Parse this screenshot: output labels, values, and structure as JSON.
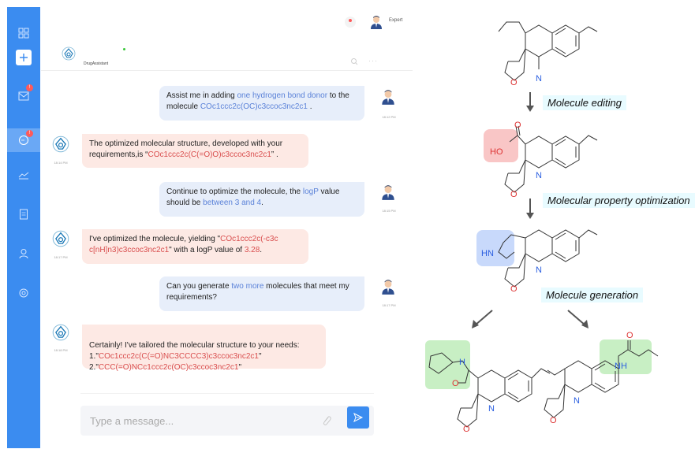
{
  "app": {
    "assistant_name": "DrugAssistant",
    "user_role": "Expert"
  },
  "sidebar": {
    "items": [
      {
        "icon": "grid-icon"
      },
      {
        "icon": "plus-icon"
      },
      {
        "icon": "mail-icon",
        "badge": "!"
      },
      {
        "icon": "chat-icon",
        "badge": "!"
      },
      {
        "icon": "chart-icon"
      },
      {
        "icon": "document-icon"
      },
      {
        "icon": "user-icon"
      },
      {
        "icon": "settings-icon"
      }
    ]
  },
  "messages": [
    {
      "role": "user",
      "time": "18:12 PM",
      "parts": [
        {
          "t": "Assist me in adding "
        },
        {
          "t": "one hydrogen bond donor",
          "c": "blue"
        },
        {
          "t": " to the molecule "
        },
        {
          "t": "COc1ccc2c(OC)c3ccoc3nc2c1",
          "c": "blue"
        },
        {
          "t": " ."
        }
      ]
    },
    {
      "role": "bot",
      "time": "18:14 PM",
      "parts": [
        {
          "t": "The optimized molecular structure, developed with your requirements,is “"
        },
        {
          "t": "COc1ccc2c(C(=O)O)c3ccoc3nc2c1",
          "c": "red"
        },
        {
          "t": "” ."
        }
      ]
    },
    {
      "role": "user",
      "time": "18:15 PM",
      "parts": [
        {
          "t": "Continue to optimize the molecule, the "
        },
        {
          "t": "logP",
          "c": "blue"
        },
        {
          "t": " value should be "
        },
        {
          "t": "between 3 and 4",
          "c": "blue"
        },
        {
          "t": "."
        }
      ]
    },
    {
      "role": "bot",
      "time": "18:17 PM",
      "parts": [
        {
          "t": "I've optimized the molecule, yielding \""
        },
        {
          "t": "COc1ccc2c(-c3c c[nH]n3)c3ccoc3nc2c1",
          "c": "red"
        },
        {
          "t": "\" with a logP value of "
        },
        {
          "t": "3.28",
          "c": "red"
        },
        {
          "t": "."
        }
      ]
    },
    {
      "role": "user",
      "time": "18:17 PM",
      "parts": [
        {
          "t": "Can you generate "
        },
        {
          "t": "two more",
          "c": "blue"
        },
        {
          "t": " molecules that meet my requirements?"
        }
      ]
    },
    {
      "role": "bot",
      "time": "18:18 PM",
      "parts": [
        {
          "t": "Certainly! I've tailored the molecular structure to your needs:"
        },
        {
          "t": "\n1.\""
        },
        {
          "t": "COc1ccc2c(C(=O)NC3CCCC3)c3ccoc3nc2c1",
          "c": "red"
        },
        {
          "t": "\"\n2.\""
        },
        {
          "t": "CCC(=O)NCc1ccc2c(OC)c3ccoc3nc2c1",
          "c": "red"
        },
        {
          "t": "\""
        }
      ]
    }
  ],
  "input": {
    "placeholder": "Type a message..."
  },
  "workflow": {
    "steps": [
      "Molecule editing",
      "Molecular property optimization",
      "Molecule generation"
    ],
    "atoms": {
      "carbonyl_o": "O",
      "hydroxyl": "HO",
      "nitrogen": "N",
      "oxygen": "O",
      "pyrazole_nh": "HN",
      "amide_nh": "NH",
      "ring_h": "H",
      "ring_n": "N"
    }
  },
  "colors": {
    "sidebar": "#3b8cf0",
    "user_bubble": "#e7eefa",
    "bot_bubble": "#fde9e4",
    "highlight_blue": "#5b82d8",
    "highlight_red": "#d94e4e",
    "edit_highlight": "#f9c6c6",
    "optimize_highlight": "#c8d9fb",
    "generate_highlight": "#c8efc4"
  }
}
